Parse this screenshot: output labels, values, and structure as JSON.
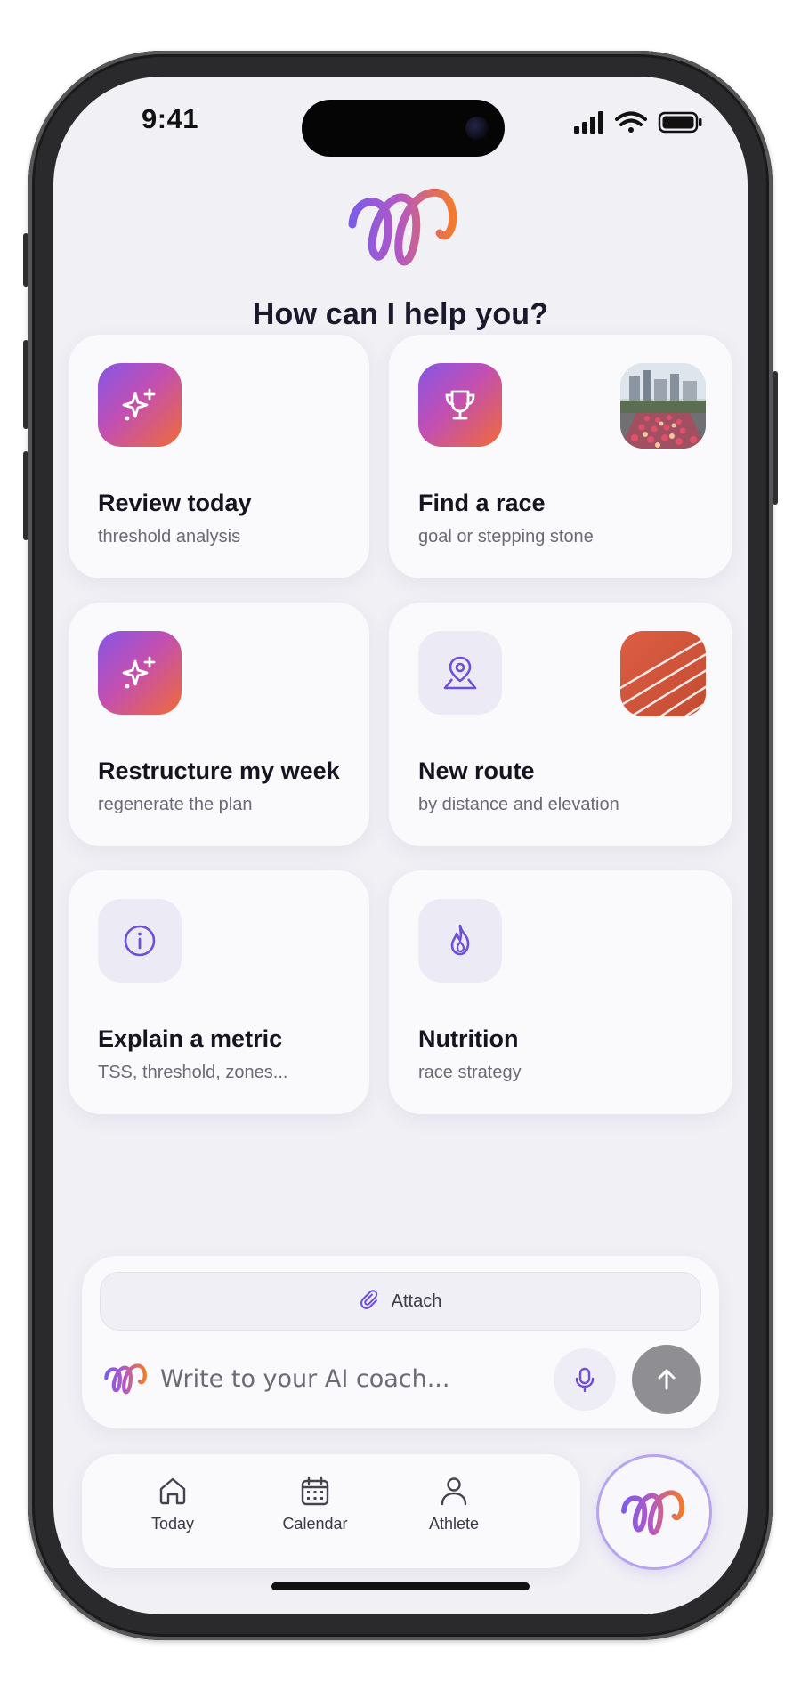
{
  "status_bar": {
    "time": "9:41"
  },
  "headline": "How can I help you?",
  "cards": [
    {
      "title": "Review today",
      "subtitle": "threshold analysis",
      "icon": "sparkles-icon"
    },
    {
      "title": "Find a race",
      "subtitle": "goal or stepping stone",
      "icon": "trophy-icon",
      "thumbnail": "city-marathon-photo"
    },
    {
      "title": "Restructure my week",
      "subtitle": "regenerate the plan",
      "icon": "sparkles-icon"
    },
    {
      "title": "New route",
      "subtitle": "by distance and elevation",
      "icon": "map-pin-icon",
      "thumbnail": "running-track-photo"
    },
    {
      "title": "Explain a metric",
      "subtitle": "TSS, threshold, zones...",
      "icon": "info-icon"
    },
    {
      "title": "Nutrition",
      "subtitle": "race strategy",
      "icon": "flame-icon"
    }
  ],
  "composer": {
    "attach_label": "Attach",
    "placeholder": "Write to your AI coach..."
  },
  "tabbar": {
    "tabs": [
      {
        "label": "Today",
        "icon": "home-icon"
      },
      {
        "label": "Calendar",
        "icon": "calendar-icon"
      },
      {
        "label": "Athlete",
        "icon": "person-icon"
      }
    ]
  },
  "colors": {
    "accent_purple": "#7a52e0",
    "accent_orange": "#f07a34",
    "screen_bg": "#f1f0f5",
    "card_bg": "#fafafc"
  }
}
